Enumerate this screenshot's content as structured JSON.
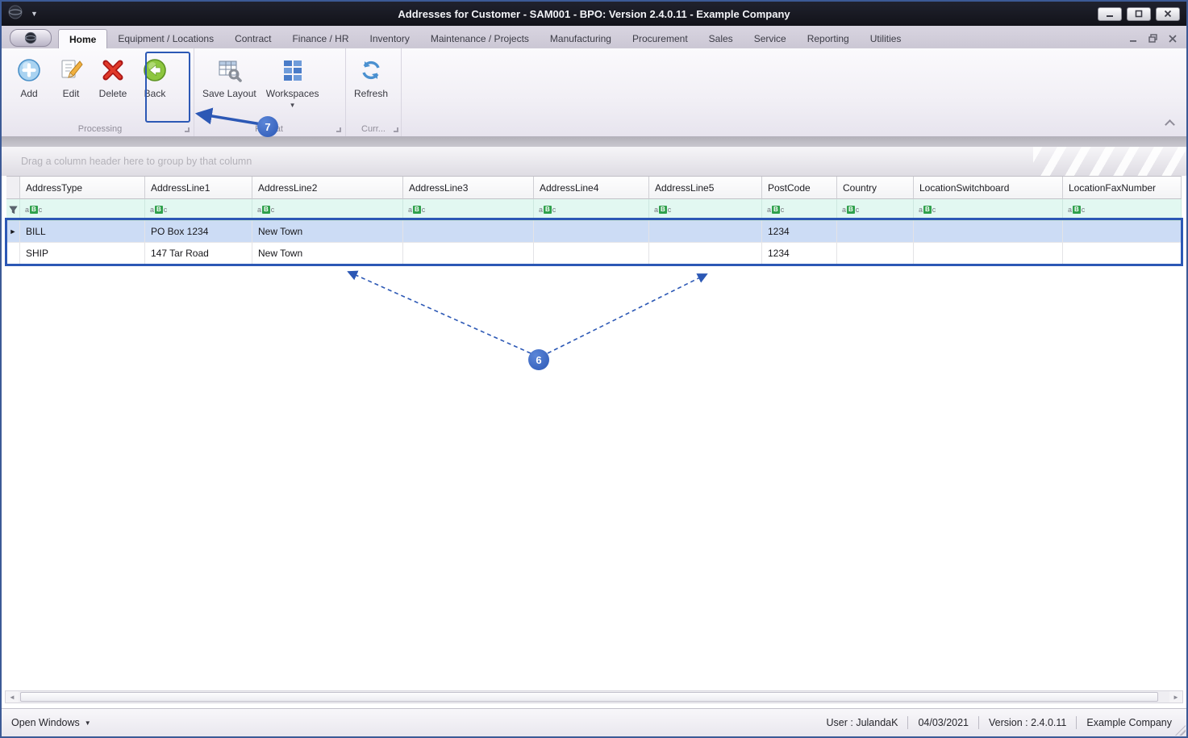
{
  "colors": {
    "accent_blue": "#2C58B5",
    "selected_row": "#CCDCF5",
    "filter_row": "#E2F8F1",
    "titlebar": "#14151D"
  },
  "window": {
    "title": "Addresses for Customer - SAM001 - BPO: Version 2.4.0.11 - Example Company"
  },
  "tabs": {
    "items": [
      {
        "label": "Home"
      },
      {
        "label": "Equipment / Locations"
      },
      {
        "label": "Contract"
      },
      {
        "label": "Finance / HR"
      },
      {
        "label": "Inventory"
      },
      {
        "label": "Maintenance / Projects"
      },
      {
        "label": "Manufacturing"
      },
      {
        "label": "Procurement"
      },
      {
        "label": "Sales"
      },
      {
        "label": "Service"
      },
      {
        "label": "Reporting"
      },
      {
        "label": "Utilities"
      }
    ]
  },
  "toolbar": {
    "buttons": {
      "add": "Add",
      "edit": "Edit",
      "delete": "Delete",
      "back": "Back",
      "save_layout": "Save Layout",
      "workspaces": "Workspaces",
      "refresh": "Refresh"
    },
    "groups": {
      "processing": "Processing",
      "format": "Format",
      "current": "Curr..."
    }
  },
  "grid": {
    "group_hint": "Drag a column header here to group by that column",
    "columns": [
      "AddressType",
      "AddressLine1",
      "AddressLine2",
      "AddressLine3",
      "AddressLine4",
      "AddressLine5",
      "PostCode",
      "Country",
      "LocationSwitchboard",
      "LocationFaxNumber"
    ],
    "filter_icon": {
      "a": "a",
      "b": "B",
      "c": "c"
    },
    "rows": [
      {
        "cells": [
          "BILL",
          "PO Box 1234",
          "New Town",
          "",
          "",
          "",
          "1234",
          "",
          "",
          ""
        ]
      },
      {
        "cells": [
          "SHIP",
          "147 Tar Road",
          "New Town",
          "",
          "",
          "",
          "1234",
          "",
          "",
          ""
        ]
      }
    ]
  },
  "annotations": {
    "six": "6",
    "seven": "7"
  },
  "status": {
    "open_windows": "Open Windows",
    "user": "User : JulandaK",
    "date": "04/03/2021",
    "version": "Version : 2.4.0.11",
    "company": "Example Company"
  }
}
